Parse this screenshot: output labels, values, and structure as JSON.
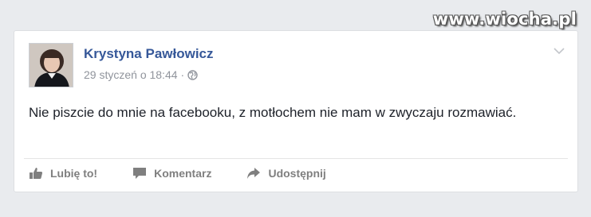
{
  "watermark": {
    "text": "www.wiocha.pl"
  },
  "post": {
    "author": "Krystyna Pawłowicz",
    "timestamp": "29 styczeń o 18:44",
    "separator": "·",
    "privacy_icon": "globe-icon",
    "text": "Nie piszcie do mnie na facebooku, z motłochem nie mam w zwyczaju rozmawiać."
  },
  "actions": {
    "like": {
      "label": "Lubię to!",
      "icon": "thumbs-up-icon"
    },
    "comment": {
      "label": "Komentarz",
      "icon": "speech-bubble-icon"
    },
    "share": {
      "label": "Udostępnij",
      "icon": "share-arrow-icon"
    }
  },
  "colors": {
    "author": "#365899",
    "meta": "#90949c",
    "text": "#1d2129",
    "action": "#7f7f7f",
    "background": "#e9ebee"
  }
}
